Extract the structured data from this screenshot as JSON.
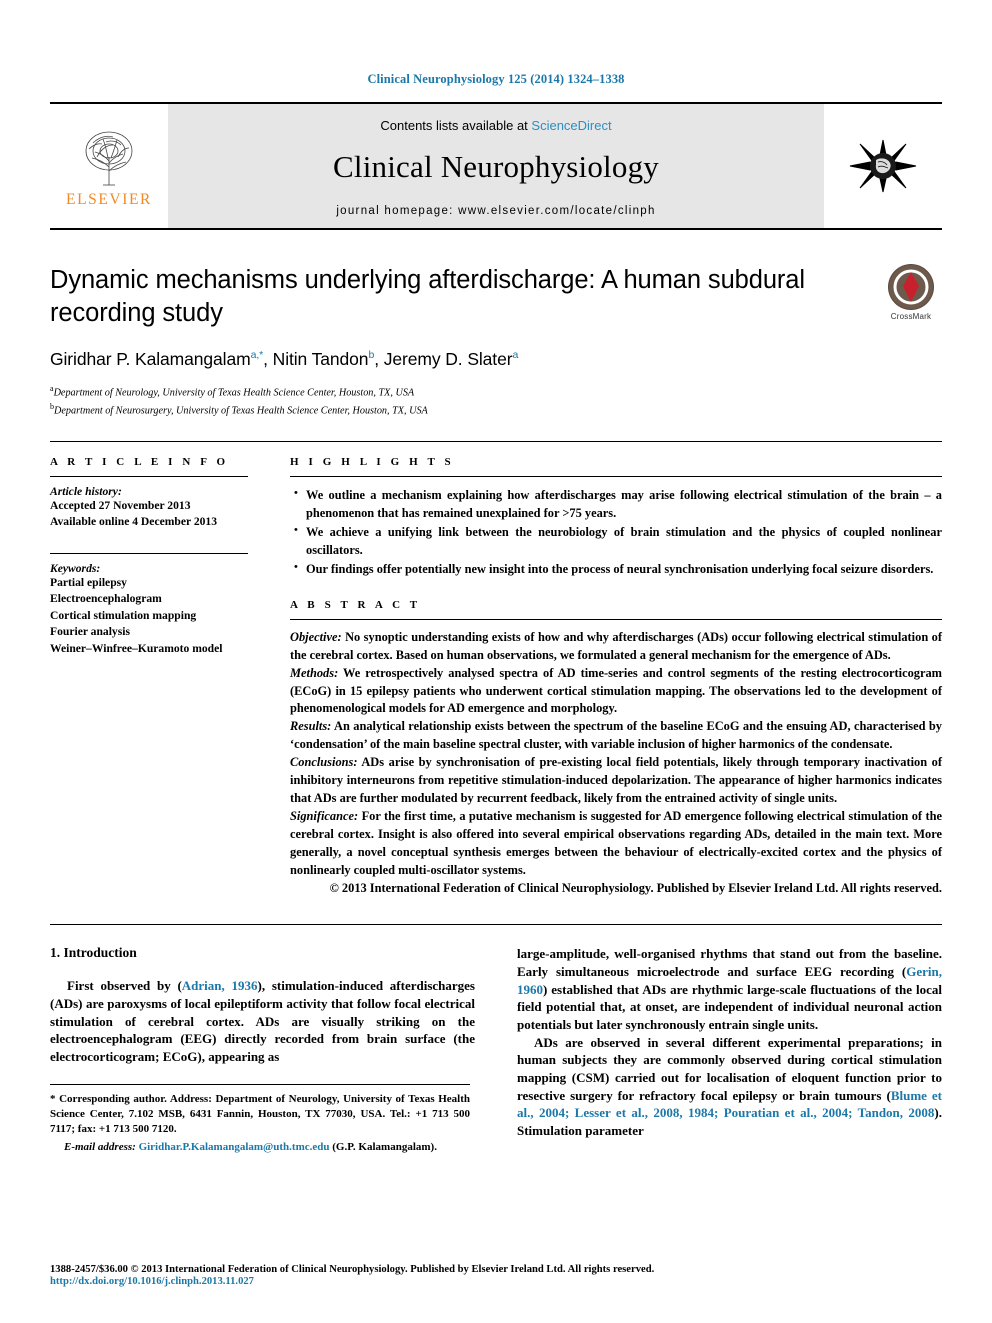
{
  "running_head": "Clinical Neurophysiology 125 (2014) 1324–1338",
  "masthead": {
    "publisher_name": "ELSEVIER",
    "contents_prefix": "Contents lists available at ",
    "contents_link": "ScienceDirect",
    "journal_title": "Clinical Neurophysiology",
    "homepage": "journal homepage: www.elsevier.com/locate/clinph"
  },
  "article": {
    "title": "Dynamic mechanisms underlying afterdischarge: A human subdural recording study",
    "authors": [
      {
        "name": "Giridhar P. Kalamangalam",
        "marks": "a,*"
      },
      {
        "name": "Nitin Tandon",
        "marks": "b"
      },
      {
        "name": "Jeremy D. Slater",
        "marks": "a"
      }
    ],
    "affiliations": [
      {
        "mark": "a",
        "text": "Department of Neurology, University of Texas Health Science Center, Houston, TX, USA"
      },
      {
        "mark": "b",
        "text": "Department of Neurosurgery, University of Texas Health Science Center, Houston, TX, USA"
      }
    ],
    "crossmark_label": "CrossMark"
  },
  "article_info": {
    "heading": "A R T I C L E   I N F O",
    "history_label": "Article history:",
    "history_lines": [
      "Accepted 27 November 2013",
      "Available online 4 December 2013"
    ],
    "keywords_label": "Keywords:",
    "keywords": [
      "Partial epilepsy",
      "Electroencephalogram",
      "Cortical stimulation mapping",
      "Fourier analysis",
      "Weiner–Winfree–Kuramoto model"
    ]
  },
  "highlights": {
    "heading": "H I G H L I G H T S",
    "items": [
      "We outline a mechanism explaining how afterdischarges may arise following electrical stimulation of the brain – a phenomenon that has remained unexplained for >75 years.",
      "We achieve a unifying link between the neurobiology of brain stimulation and the physics of coupled nonlinear oscillators.",
      "Our findings offer potentially new insight into the process of neural synchronisation underlying focal seizure disorders."
    ]
  },
  "abstract": {
    "heading": "A B S T R A C T",
    "sections": [
      {
        "label": "Objective:",
        "text": " No synoptic understanding exists of how and why afterdischarges (ADs) occur following electrical stimulation of the cerebral cortex. Based on human observations, we formulated a general mechanism for the emergence of ADs."
      },
      {
        "label": "Methods:",
        "text": " We retrospectively analysed spectra of AD time-series and control segments of the resting electrocorticogram (ECoG) in 15 epilepsy patients who underwent cortical stimulation mapping. The observations led to the development of phenomenological models for AD emergence and morphology."
      },
      {
        "label": "Results:",
        "text": " An analytical relationship exists between the spectrum of the baseline ECoG and the ensuing AD, characterised by ‘condensation’ of the main baseline spectral cluster, with variable inclusion of higher harmonics of the condensate."
      },
      {
        "label": "Conclusions:",
        "text": " ADs arise by synchronisation of pre-existing local field potentials, likely through temporary inactivation of inhibitory interneurons from repetitive stimulation-induced depolarization. The appearance of higher harmonics indicates that ADs are further modulated by recurrent feedback, likely from the entrained activity of single units."
      },
      {
        "label": "Significance:",
        "text": " For the first time, a putative mechanism is suggested for AD emergence following electrical stimulation of the cerebral cortex. Insight is also offered into several empirical observations regarding ADs, detailed in the main text. More generally, a novel conceptual synthesis emerges between the behaviour of electrically-excited cortex and the physics of nonlinearly coupled multi-oscillator systems."
      }
    ],
    "copyright": "© 2013 International Federation of Clinical Neurophysiology. Published by Elsevier Ireland Ltd. All rights reserved."
  },
  "body": {
    "section_heading": "1. Introduction",
    "left_paragraph_pre": "First observed by (",
    "left_citation_1": "Adrian, 1936",
    "left_paragraph_post": "), stimulation-induced afterdischarges (ADs) are paroxysms of local epileptiform activity that follow focal electrical stimulation of cerebral cortex. ADs are visually striking on the electroencephalogram (EEG) directly recorded from brain surface (the electrocorticogram; ECoG), appearing as",
    "right_paragraph_1_pre": "large-amplitude, well-organised rhythms that stand out from the baseline. Early simultaneous microelectrode and surface EEG recording (",
    "right_citation_1": "Gerin, 1960",
    "right_paragraph_1_post": ") established that ADs are rhythmic large-scale fluctuations of the local field potential that, at onset, are independent of individual neuronal action potentials but later synchronously entrain single units.",
    "right_paragraph_2_pre": "ADs are observed in several different experimental preparations; in human subjects they are commonly observed during cortical stimulation mapping (CSM) carried out for localisation of eloquent function prior to resective surgery for refractory focal epilepsy or brain tumours (",
    "right_citation_2": "Blume et al., 2004; Lesser et al., 2008, 1984; Pouratian et al., 2004; Tandon, 2008",
    "right_paragraph_2_post": "). Stimulation parameter"
  },
  "footnote": {
    "corresponding": "* Corresponding author. Address: Department of Neurology, University of Texas Health Science Center, 7.102 MSB, 6431 Fannin, Houston, TX 77030, USA. Tel.: +1 713 500 7117; fax: +1 713 500 7120.",
    "email_label": "E-mail address:",
    "email": "Giridhar.P.Kalamangalam@uth.tmc.edu",
    "email_suffix": " (G.P. Kalamangalam)."
  },
  "page_footer": {
    "issn": "1388-2457/$36.00 © 2013 International Federation of Clinical Neurophysiology. Published by Elsevier Ireland Ltd. All rights reserved.",
    "doi": "http://dx.doi.org/10.1016/j.clinph.2013.11.027"
  },
  "colors": {
    "link_blue": "#1b78a8",
    "sciencedirect_blue": "#2b8fc4",
    "elsevier_orange": "#f08a24",
    "masthead_grey": "#e6e6e6"
  }
}
